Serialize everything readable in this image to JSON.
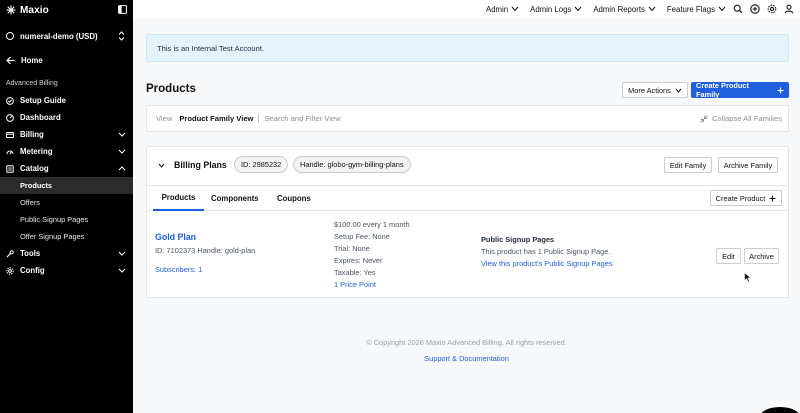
{
  "brand": {
    "name": "Maxio"
  },
  "site": {
    "name": "numeral-demo (USD)"
  },
  "home": {
    "label": "Home"
  },
  "sidebar": {
    "section_title": "Advanced Billing",
    "items": [
      {
        "label": "Setup Guide"
      },
      {
        "label": "Dashboard"
      },
      {
        "label": "Billing"
      },
      {
        "label": "Metering"
      },
      {
        "label": "Catalog"
      },
      {
        "label": "Tools"
      },
      {
        "label": "Config"
      }
    ],
    "catalog_sub": [
      {
        "label": "Products"
      },
      {
        "label": "Offers"
      },
      {
        "label": "Public Signup Pages"
      },
      {
        "label": "Offer Signup Pages"
      }
    ]
  },
  "topbar": {
    "menus": [
      {
        "label": "Admin"
      },
      {
        "label": "Admin Logs"
      },
      {
        "label": "Admin Reports"
      },
      {
        "label": "Feature Flags"
      }
    ]
  },
  "notice": {
    "text": "This is an Internal Test Account."
  },
  "page": {
    "title": "Products",
    "more_actions": "More Actions",
    "create_family": "Create Product Family"
  },
  "view_bar": {
    "view_label": "View",
    "family_view": "Product Family View",
    "search_view": "Search and Filter View",
    "collapse_all": "Collapse All Families"
  },
  "family": {
    "name": "Billing Plans",
    "id_pill": "ID: 2985232",
    "handle_pill": "Handle: globo-gym-billing-plans",
    "edit": "Edit Family",
    "archive": "Archive Family",
    "tabs": [
      {
        "label": "Products"
      },
      {
        "label": "Components"
      },
      {
        "label": "Coupons"
      }
    ],
    "create_product": "Create Product"
  },
  "product": {
    "name": "Gold Plan",
    "meta": "ID: 7102373 Handle: gold-plan",
    "subscribers": "Subscribers: 1",
    "price": "$100.00 every 1 month",
    "setup_fee": "Setup Fee: None",
    "trial": "Trial: None",
    "expires": "Expires: Never",
    "taxable": "Taxable: Yes",
    "price_points": "1 Price Point",
    "signup_title": "Public Signup Pages",
    "signup_text": "This product has 1 Public Signup Page.",
    "signup_link": "View this product's Public Signup Pages",
    "edit": "Edit",
    "archive": "Archive"
  },
  "footer": {
    "copyright": "© Copyright 2026 Maxio Advanced Billing. All rights reserved.",
    "support": "Support & Documentation"
  },
  "colors": {
    "accent": "#1f5fde",
    "sidebar_bg": "#000000",
    "notice_bg": "#e4f3fc"
  }
}
